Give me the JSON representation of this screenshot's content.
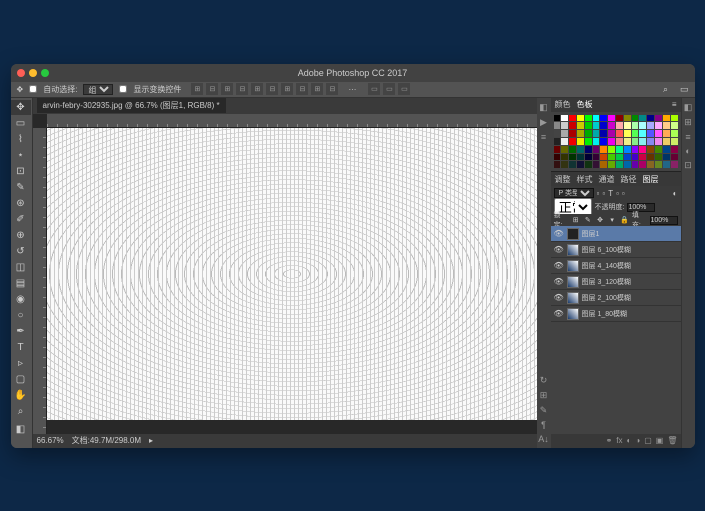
{
  "title": "Adobe Photoshop CC 2017",
  "optbar": {
    "label1": "自动选择:",
    "dropdown1": "组",
    "checkbox_label": "显示变换控件",
    "more_label": "···"
  },
  "document": {
    "tab": "arvin-febry-302935.jpg @ 66.7% (图层1, RGB/8) *",
    "zoom": "66.67%",
    "docsize": "文档:49.7M/298.0M"
  },
  "swatches_tabs": {
    "t1": "颜色",
    "t2": "色板"
  },
  "swatch_colors": [
    "#000",
    "#fff",
    "#f00",
    "#ff0",
    "#0f0",
    "#0ff",
    "#00f",
    "#f0f",
    "#800",
    "#880",
    "#080",
    "#088",
    "#008",
    "#808",
    "#fa0",
    "#af0",
    "#888",
    "#ccc",
    "#c00",
    "#cc0",
    "#0c0",
    "#0cc",
    "#00c",
    "#c0c",
    "#faa",
    "#ffa",
    "#afa",
    "#aff",
    "#aaf",
    "#faf",
    "#fc8",
    "#cf8",
    "#444",
    "#aaa",
    "#a00",
    "#aa0",
    "#0a0",
    "#0aa",
    "#00a",
    "#a0a",
    "#f55",
    "#ff5",
    "#5f5",
    "#5ff",
    "#55f",
    "#f5f",
    "#fa5",
    "#af5",
    "#222",
    "#eee",
    "#e00",
    "#ee0",
    "#0e0",
    "#0ee",
    "#00e",
    "#e0e",
    "#e88",
    "#ee8",
    "#8e8",
    "#8ee",
    "#88e",
    "#e8e",
    "#ec6",
    "#ce6",
    "#600",
    "#660",
    "#060",
    "#066",
    "#006",
    "#606",
    "#f80",
    "#8f0",
    "#0f8",
    "#08f",
    "#80f",
    "#f08",
    "#840",
    "#480",
    "#048",
    "#804",
    "#300",
    "#330",
    "#030",
    "#033",
    "#003",
    "#303",
    "#c40",
    "#4c0",
    "#0c4",
    "#04c",
    "#40c",
    "#c04",
    "#630",
    "#360",
    "#036",
    "#603",
    "#311",
    "#331",
    "#133",
    "#113",
    "#131",
    "#313",
    "#a60",
    "#6a0",
    "#0a6",
    "#06a",
    "#60a",
    "#a06",
    "#862",
    "#682",
    "#268",
    "#826"
  ],
  "layers_tabs": {
    "t1": "调整",
    "t2": "样式",
    "t3": "通道",
    "t4": "路径",
    "t5": "图层"
  },
  "layer_opts": {
    "kind": "P 类型",
    "blend": "正常",
    "opacity_label": "不透明度:",
    "opacity": "100%",
    "fill_label": "填充:",
    "fill": "100%",
    "lock_label": "锁定:"
  },
  "layers": [
    {
      "name": "图层1",
      "sel": true,
      "art": false
    },
    {
      "name": "图层 6_100模糊",
      "sel": false,
      "art": true
    },
    {
      "name": "图层 4_140模糊",
      "sel": false,
      "art": true
    },
    {
      "name": "图层 3_120模糊",
      "sel": false,
      "art": true
    },
    {
      "name": "图层 2_100模糊",
      "sel": false,
      "art": true
    },
    {
      "name": "图层 1_80模糊",
      "sel": false,
      "art": true
    }
  ]
}
